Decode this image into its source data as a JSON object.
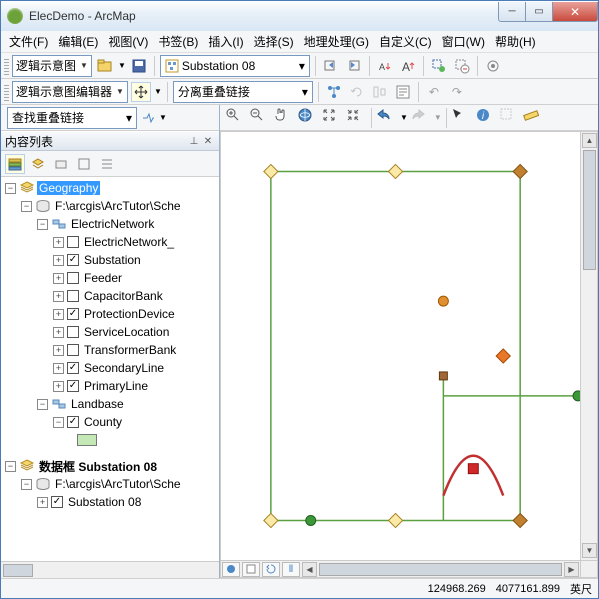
{
  "window": {
    "title": "ElecDemo - ArcMap"
  },
  "menu": [
    "文件(F)",
    "编辑(E)",
    "视图(V)",
    "书签(B)",
    "插入(I)",
    "选择(S)",
    "地理处理(G)",
    "自定义(C)",
    "窗口(W)",
    "帮助(H)"
  ],
  "tb1": {
    "schematic_label": "逻辑示意图",
    "combo_value": "Substation 08"
  },
  "tb2": {
    "editor_label": "逻辑示意图编辑器",
    "combo_value": "分离重叠链接"
  },
  "tb3": {
    "combo_value": "查找重叠链接"
  },
  "toc": {
    "title": "内容列表",
    "df1": "Geography",
    "path1": "F:\\arcgis\\ArcTutor\\Sche",
    "group1": "ElectricNetwork",
    "layers1": [
      "ElectricNetwork_",
      "Substation",
      "Feeder",
      "CapacitorBank",
      "ProtectionDevice",
      "ServiceLocation",
      "TransformerBank",
      "SecondaryLine",
      "PrimaryLine"
    ],
    "group2": "Landbase",
    "layers2": [
      "County"
    ],
    "df2": "数据框 Substation 08",
    "path2": "F:\\arcgis\\ArcTutor\\Sche",
    "layers3": [
      "Substation 08"
    ]
  },
  "status": {
    "x": "124968.269",
    "y": "4077161.899",
    "unit": "英尺"
  }
}
